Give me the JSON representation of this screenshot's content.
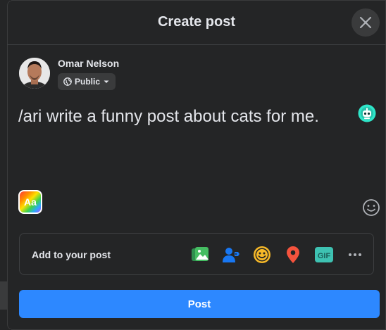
{
  "dialog": {
    "title": "Create post"
  },
  "user": {
    "name": "Omar Nelson",
    "privacy_label": "Public"
  },
  "composer": {
    "text": "/ari write a funny post about cats for me.",
    "text_format_label": "Aa"
  },
  "add_to_post": {
    "label": "Add to your post",
    "options": [
      {
        "name": "photo-video-icon",
        "color": "#45bd62"
      },
      {
        "name": "tag-people-icon",
        "color": "#1877f2"
      },
      {
        "name": "feeling-activity-icon",
        "color": "#f7b928"
      },
      {
        "name": "check-in-icon",
        "color": "#f5533d"
      },
      {
        "name": "gif-icon",
        "color": "#3ec2b2",
        "label": "GIF"
      },
      {
        "name": "more-options-icon",
        "color": "#b0b3b8"
      }
    ]
  },
  "footer": {
    "post_label": "Post"
  },
  "colors": {
    "accent": "#2d88ff",
    "surface": "#242526",
    "text": "#e4e6eb"
  }
}
